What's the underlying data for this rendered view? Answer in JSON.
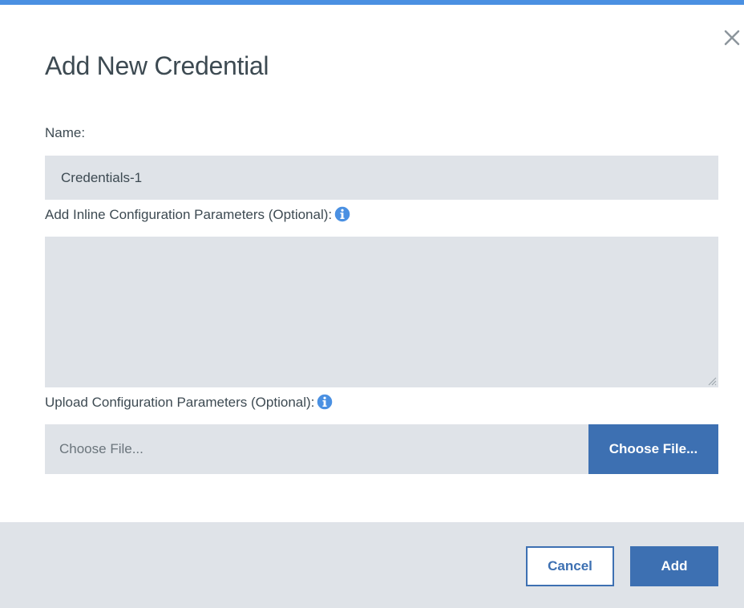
{
  "dialog": {
    "title": "Add New Credential"
  },
  "icons": {
    "close": "close-icon",
    "info": "info-icon",
    "resize": "resize-grip-icon"
  },
  "colors": {
    "accent": "#4a90e2",
    "primary_button": "#3d70b2",
    "field_background": "#dfe3e8",
    "text": "#3d4a52"
  },
  "form": {
    "name": {
      "label": "Name:",
      "value": "Credentials-1"
    },
    "inline_params": {
      "label": "Add Inline Configuration Parameters (Optional):",
      "value": ""
    },
    "upload_params": {
      "label": "Upload Configuration Parameters (Optional):",
      "file_placeholder": "Choose File...",
      "button_label": "Choose File..."
    }
  },
  "footer": {
    "cancel_label": "Cancel",
    "add_label": "Add"
  }
}
